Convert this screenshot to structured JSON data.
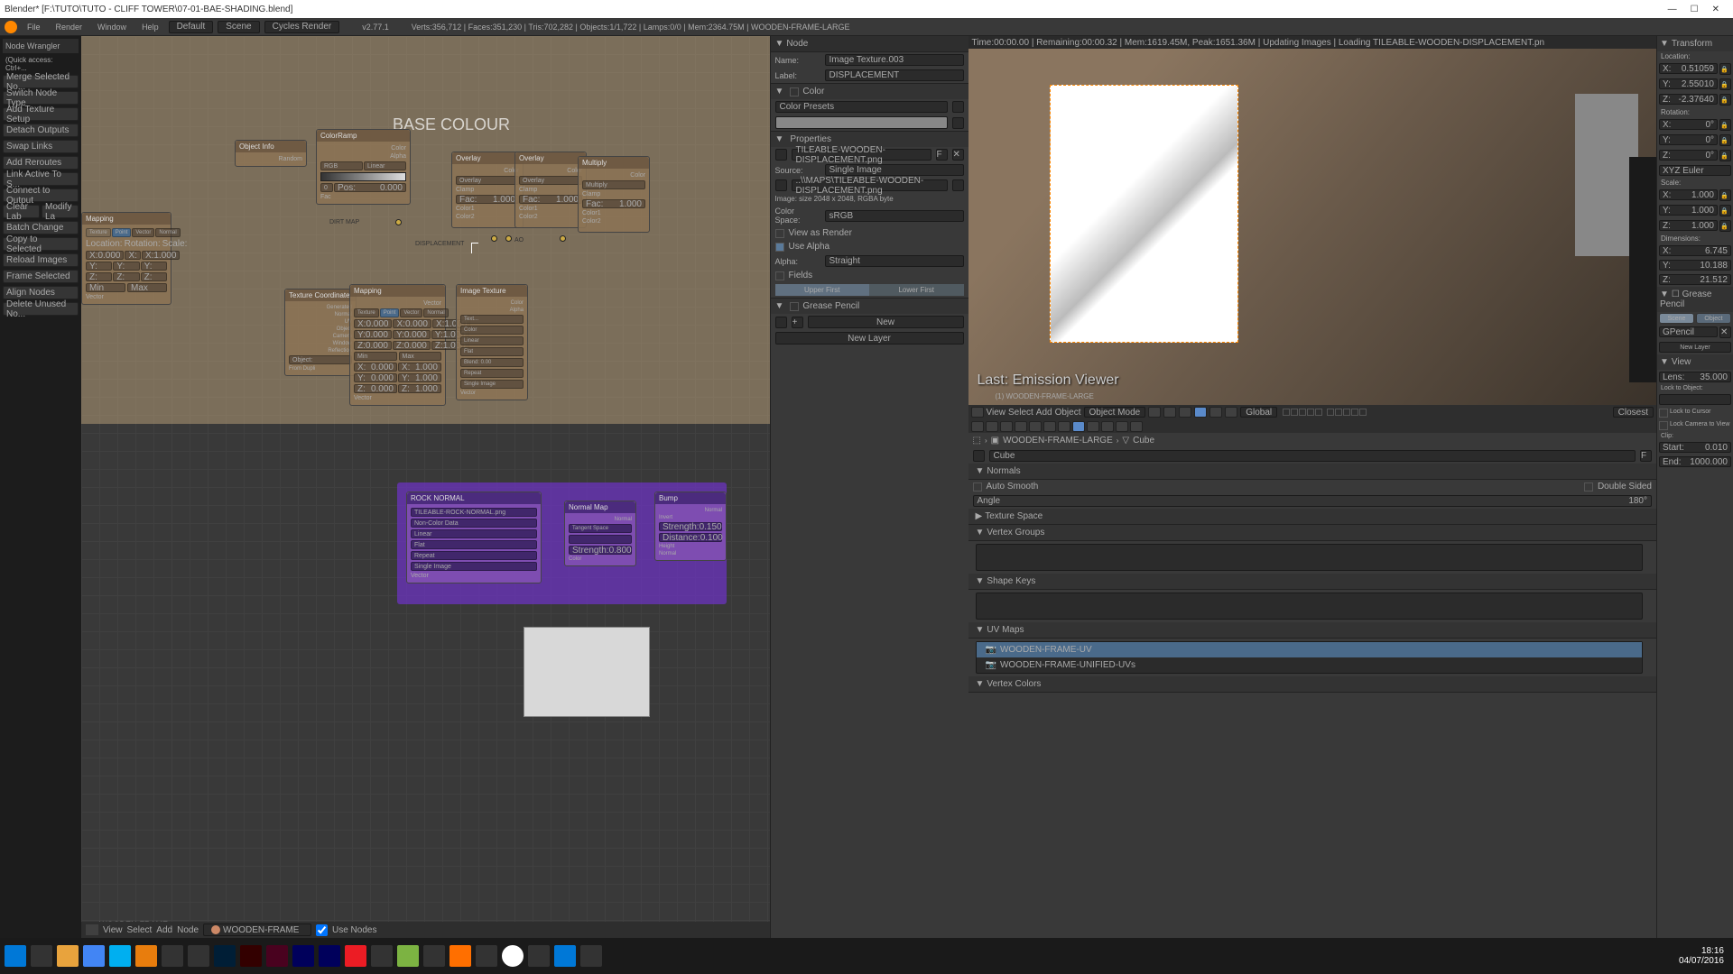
{
  "title": "Blender* [F:\\TUTO\\TUTO - CLIFF TOWER\\07-01-BAE-SHADING.blend]",
  "titlebar_controls": {
    "min": "—",
    "max": "☐",
    "close": "✕"
  },
  "info": {
    "menus": [
      "File",
      "Render",
      "Window",
      "Help"
    ],
    "layout": "Default",
    "scene": "Scene",
    "engine": "Cycles Render",
    "version": "v2.77.1",
    "stats": "Verts:356,712 | Faces:351,230 | Tris:702,282 | Objects:1/1,722 | Lamps:0/0 | Mem:2364.75M | WOODEN-FRAME-LARGE"
  },
  "nw": {
    "title": "Node Wrangler",
    "quick": "(Quick access: Ctrl+...",
    "buttons": [
      "Merge Selected No...",
      "Switch Node Type",
      "Add Texture Setup",
      "Detach Outputs",
      "Swap Links",
      "Add Reroutes",
      "Link Active To S...",
      "Connect to Output",
      "Clear Lab",
      "Modify La",
      "Batch Change",
      "Copy to Selected",
      "Reload Images",
      "Frame Selected",
      "Align Nodes",
      "Delete Unused No..."
    ]
  },
  "nodes": {
    "frame_title": "BASE COLOUR",
    "object_info": "Object Info",
    "colorramp": "ColorRamp",
    "dirt_map": "DIRT MAP",
    "displacement": "DISPLACEMENT",
    "overlay1": "Overlay",
    "overlay2": "Overlay",
    "multiply": "Multiply",
    "ao": "AO",
    "tex_coord": "Texture Coordinate",
    "mapping": "Mapping",
    "image_tex": "Image Texture",
    "rock_normal": "ROCK NORMAL",
    "rock_file": "TILEABLE-ROCK-NORMAL.png",
    "normal_map": "Normal Map",
    "bump": "Bump",
    "bottom_label": "WOODEN-FRAME",
    "tabs": [
      "Texture",
      "Point",
      "Vector",
      "Normal"
    ],
    "tex_outputs": [
      "Generated",
      "Normal",
      "UV",
      "Object",
      "Camera",
      "Window",
      "Reflection"
    ],
    "mapping_fields": {
      "location": "Location:",
      "rotation": "Rotation:",
      "scale": "Scale:",
      "min": "Min",
      "max": "Max",
      "x": "X:",
      "y": "Y:",
      "z": "Z:",
      "val0": "0.000",
      "val1": "1.000"
    },
    "overlay_fields": {
      "color": "Color",
      "overlay": "Overlay",
      "clamp": "Clamp",
      "fac": "Fac:",
      "fac_val": "1.000",
      "color1": "Color1",
      "color2": "Color2"
    },
    "img_fields": {
      "color": "Color",
      "alpha": "Alpha",
      "linear": "Linear",
      "flat": "Flat",
      "repeat": "Repeat",
      "single": "Single Image",
      "vector": "Vector",
      "noncolor": "Non-Color Data"
    },
    "bump_fields": {
      "invert": "Invert",
      "normal": "Normal",
      "strength": "Strength:",
      "sval": "0.150",
      "distance": "Distance:",
      "dval": "0.100",
      "height": "Height"
    },
    "normal_fields": {
      "tangent": "Tangent Space",
      "strength": "Strength:",
      "sval": "0.800",
      "color": "Color"
    },
    "colorramp_fields": {
      "color": "Color",
      "alpha": "Alpha",
      "rgb": "RGB",
      "linear": "Linear",
      "pos": "Pos:",
      "pos_val": "0.000",
      "fac": "Fac"
    }
  },
  "ne_bottom": {
    "menus": [
      "View",
      "Select",
      "Add",
      "Node"
    ],
    "material": "WOODEN-FRAME",
    "use_nodes": "Use Nodes"
  },
  "props": {
    "node_header": "Node",
    "name_label": "Name:",
    "name_val": "Image Texture.003",
    "label_label": "Label:",
    "label_val": "DISPLACEMENT",
    "color_section": "Color",
    "color_presets": "Color Presets",
    "properties_section": "Properties",
    "filename": "TILEABLE-WOODEN-DISPLACEMENT.png",
    "source": "Source:",
    "source_val": "Single Image",
    "path": "..\\\\MAPS\\TILEABLE-WOODEN-DISPLACEMENT.png",
    "img_info": "Image: size 2048 x 2048, RGBA byte",
    "colorspace": "Color Space:",
    "colorspace_val": "sRGB",
    "view_render": "View as Render",
    "use_alpha": "Use Alpha",
    "alpha": "Alpha:",
    "alpha_val": "Straight",
    "fields": "Fields",
    "upper": "Upper First",
    "lower": "Lower First",
    "grease": "Grease Pencil",
    "new": "New",
    "new_layer": "New Layer"
  },
  "render": {
    "status": "Time:00:00.00 | Remaining:00:00.32 | Mem:1619.45M, Peak:1651.36M | Updating Images | Loading TILEABLE-WOODEN-DISPLACEMENT.pn",
    "last": "Last: Emission Viewer",
    "obj": "(1) WOODEN-FRAME-LARGE"
  },
  "vheader": {
    "menus": [
      "View",
      "Select",
      "Add",
      "Object"
    ],
    "mode": "Object Mode",
    "orient": "Global"
  },
  "outliner": {
    "obj": "WOODEN-FRAME-LARGE",
    "cube": "Cube",
    "mesh": "Cube",
    "sections": {
      "normals": "Normals",
      "auto_smooth": "Auto Smooth",
      "angle": "Angle",
      "angle_val": "180°",
      "double_sided": "Double Sided",
      "texspace": "Texture Space",
      "vgroups": "Vertex Groups",
      "shapekeys": "Shape Keys",
      "uvmaps": "UV Maps",
      "vcolors": "Vertex Colors"
    },
    "uv1": "WOODEN-FRAME-UV",
    "uv2": "WOODEN-FRAME-UNIFIED-UVs"
  },
  "npanel": {
    "transform": "Transform",
    "location": "Location:",
    "loc": {
      "x": "0.51059",
      "y": "2.55010",
      "z": "-2.37640"
    },
    "rotation": "Rotation:",
    "rot": {
      "x": "0°",
      "y": "0°",
      "z": "0°"
    },
    "rotmode": "XYZ Euler",
    "scale": "Scale:",
    "scl": {
      "x": "1.000",
      "y": "1.000",
      "z": "1.000"
    },
    "dimensions": "Dimensions:",
    "dim": {
      "x": "6.745",
      "y": "10.188",
      "z": "21.512"
    },
    "grease": "Grease Pencil",
    "scene_btn": "Scene",
    "object_btn": "Object",
    "gp": "GPencil",
    "new_layer": "New Layer",
    "view": "View",
    "lens": "Lens:",
    "lens_val": "35.000",
    "lock_obj": "Lock to Object:",
    "lock_cursor": "Lock to Cursor",
    "lock_cam": "Lock Camera to View",
    "clip": "Clip:",
    "start": "Start:",
    "start_val": "0.010",
    "end": "End:",
    "end_val": "1000.000",
    "shading": "Closest"
  },
  "taskbar": {
    "time": "18:16",
    "date": "04/07/2016"
  }
}
